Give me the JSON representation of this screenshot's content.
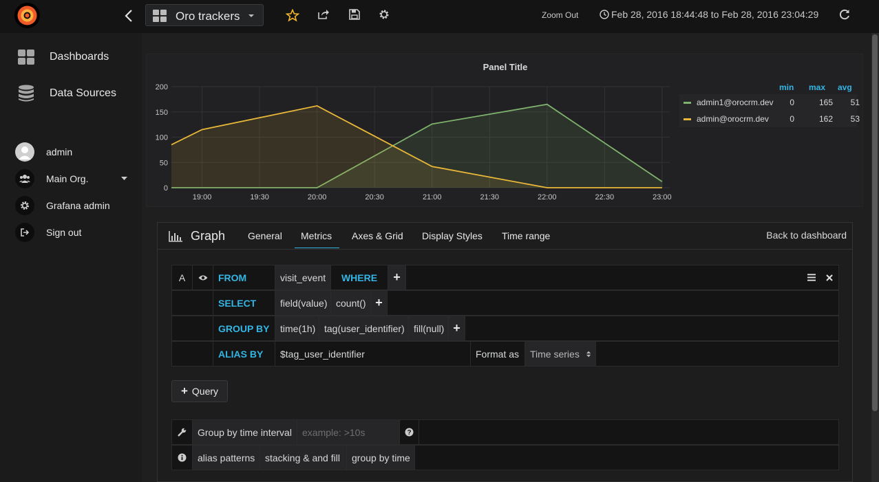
{
  "topbar": {
    "dashboard_title": "Oro trackers",
    "zoom_out": "Zoom Out",
    "time_range": "Feb 28, 2016 18:44:48 to Feb 28, 2016 23:04:29"
  },
  "sidebar": {
    "main": [
      {
        "label": "Dashboards",
        "icon": "dashboards-icon"
      },
      {
        "label": "Data Sources",
        "icon": "database-icon"
      }
    ],
    "user": [
      {
        "label": "admin",
        "icon": "avatar"
      },
      {
        "label": "Main Org.",
        "icon": "users-icon"
      },
      {
        "label": "Grafana admin",
        "icon": "gear-icon"
      },
      {
        "label": "Sign out",
        "icon": "sign-out-icon"
      }
    ]
  },
  "panel": {
    "title": "Panel Title"
  },
  "chart_data": {
    "type": "line",
    "title": "Panel Title",
    "x": [
      "18:44",
      "19:00",
      "20:00",
      "21:00",
      "22:00",
      "23:00"
    ],
    "x_ticks": [
      "19:00",
      "19:30",
      "20:00",
      "20:30",
      "21:00",
      "21:30",
      "22:00",
      "22:30",
      "23:00"
    ],
    "y_ticks": [
      "0",
      "50",
      "100",
      "150",
      "200"
    ],
    "ylim": [
      0,
      200
    ],
    "fill": true,
    "grid": true,
    "legend_position": "right",
    "series": [
      {
        "name": "admin1@orocrm.dev",
        "color": "#7eb26d",
        "values": [
          0,
          0,
          0,
          126,
          165,
          12
        ]
      },
      {
        "name": "admin@orocrm.dev",
        "color": "#eab839",
        "values": [
          85,
          115,
          162,
          42,
          0,
          0
        ]
      }
    ]
  },
  "legend": {
    "headers": {
      "min": "min",
      "max": "max",
      "avg": "avg"
    },
    "rows": [
      {
        "name": "admin1@orocrm.dev",
        "min": "0",
        "max": "165",
        "avg": "51"
      },
      {
        "name": "admin@orocrm.dev",
        "min": "0",
        "max": "162",
        "avg": "53"
      }
    ]
  },
  "editor": {
    "title": "Graph",
    "tabs": [
      "General",
      "Metrics",
      "Axes & Grid",
      "Display Styles",
      "Time range"
    ],
    "back": "Back to dashboard",
    "query": {
      "ref": "A",
      "from_kw": "FROM",
      "measurement": "visit_event",
      "where_kw": "WHERE",
      "select_kw": "SELECT",
      "select_field": "field(value)",
      "select_fn": "count()",
      "groupby_kw": "GROUP BY",
      "groupby": [
        "time(1h)",
        "tag(user_identifier)",
        "fill(null)"
      ],
      "alias_kw": "ALIAS BY",
      "alias_value": "$tag_user_identifier",
      "format_label": "Format as",
      "format_value": "Time series"
    },
    "add_query": "Query",
    "interval_label": "Group by time interval",
    "interval_placeholder": "example: >10s",
    "help": [
      "alias patterns",
      "stacking & and fill",
      "group by time"
    ]
  }
}
